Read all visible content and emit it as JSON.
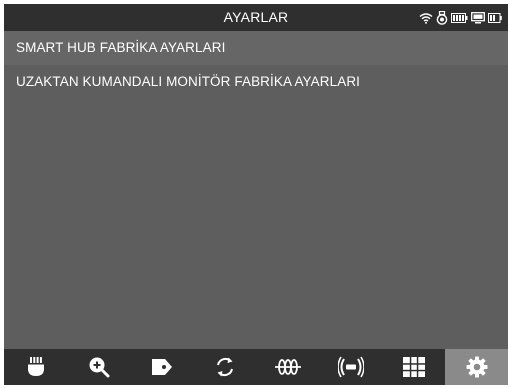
{
  "header": {
    "title": "AYARLAR",
    "status_icons": [
      "wifi-icon",
      "camera-icon",
      "battery-icon",
      "monitor-icon",
      "battery-small-icon"
    ]
  },
  "menu": {
    "items": [
      {
        "label": "SMART HUB FABRİKA AYARLARI",
        "selected": true
      },
      {
        "label": "UZAKTAN KUMANDALI MONİTÖR FABRİKA AYARLARI",
        "selected": false
      }
    ]
  },
  "toolbar": {
    "items": [
      {
        "icon": "hub-icon"
      },
      {
        "icon": "zoom-in-icon"
      },
      {
        "icon": "tag-icon"
      },
      {
        "icon": "rotate-icon"
      },
      {
        "icon": "coil-icon"
      },
      {
        "icon": "signal-icon"
      },
      {
        "icon": "grid-icon"
      },
      {
        "icon": "settings-icon",
        "active": true
      }
    ]
  },
  "colors": {
    "background": "#5e5e5e",
    "bar": "#2f2f2f",
    "selected_row": "#666666",
    "active_tab": "#8a8a8a",
    "text": "#ffffff"
  }
}
